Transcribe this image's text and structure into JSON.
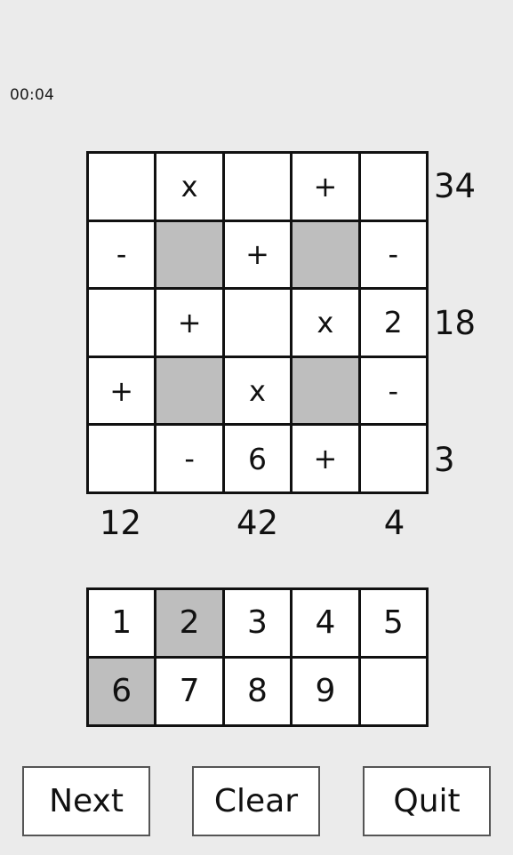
{
  "app": {
    "background_color": "#ebebeb",
    "blocked_cell_color": "#bebebe",
    "line_color": "#111111"
  },
  "status": {
    "timer_label": "00:04"
  },
  "puzzle": {
    "rows": 5,
    "columns": 5,
    "cells": [
      [
        {
          "value": "",
          "blocked": false,
          "kind": "number"
        },
        {
          "value": "x",
          "blocked": false,
          "kind": "operator"
        },
        {
          "value": "",
          "blocked": false,
          "kind": "number"
        },
        {
          "value": "+",
          "blocked": false,
          "kind": "operator"
        },
        {
          "value": "",
          "blocked": false,
          "kind": "number"
        }
      ],
      [
        {
          "value": "-",
          "blocked": false,
          "kind": "operator"
        },
        {
          "value": "",
          "blocked": true,
          "kind": "blocked"
        },
        {
          "value": "+",
          "blocked": false,
          "kind": "operator"
        },
        {
          "value": "",
          "blocked": true,
          "kind": "blocked"
        },
        {
          "value": "-",
          "blocked": false,
          "kind": "operator"
        }
      ],
      [
        {
          "value": "",
          "blocked": false,
          "kind": "number"
        },
        {
          "value": "+",
          "blocked": false,
          "kind": "operator"
        },
        {
          "value": "",
          "blocked": false,
          "kind": "number"
        },
        {
          "value": "x",
          "blocked": false,
          "kind": "operator"
        },
        {
          "value": "2",
          "blocked": false,
          "kind": "number"
        }
      ],
      [
        {
          "value": "+",
          "blocked": false,
          "kind": "operator"
        },
        {
          "value": "",
          "blocked": true,
          "kind": "blocked"
        },
        {
          "value": "x",
          "blocked": false,
          "kind": "operator"
        },
        {
          "value": "",
          "blocked": true,
          "kind": "blocked"
        },
        {
          "value": "-",
          "blocked": false,
          "kind": "operator"
        }
      ],
      [
        {
          "value": "",
          "blocked": false,
          "kind": "number"
        },
        {
          "value": "-",
          "blocked": false,
          "kind": "operator"
        },
        {
          "value": "6",
          "blocked": false,
          "kind": "number"
        },
        {
          "value": "+",
          "blocked": false,
          "kind": "operator"
        },
        {
          "value": "",
          "blocked": false,
          "kind": "number"
        }
      ]
    ],
    "row_results": [
      "34",
      "",
      "18",
      "",
      "3"
    ],
    "column_results": [
      "12",
      "",
      "42",
      "",
      "4"
    ]
  },
  "tray": {
    "rows": 2,
    "columns": 5,
    "tiles": [
      {
        "value": "1",
        "used": false
      },
      {
        "value": "2",
        "used": true
      },
      {
        "value": "3",
        "used": false
      },
      {
        "value": "4",
        "used": false
      },
      {
        "value": "5",
        "used": false
      },
      {
        "value": "6",
        "used": true
      },
      {
        "value": "7",
        "used": false
      },
      {
        "value": "8",
        "used": false
      },
      {
        "value": "9",
        "used": false
      },
      {
        "value": "",
        "used": false
      }
    ]
  },
  "controls": {
    "next_label": "Next",
    "clear_label": "Clear",
    "quit_label": "Quit"
  }
}
